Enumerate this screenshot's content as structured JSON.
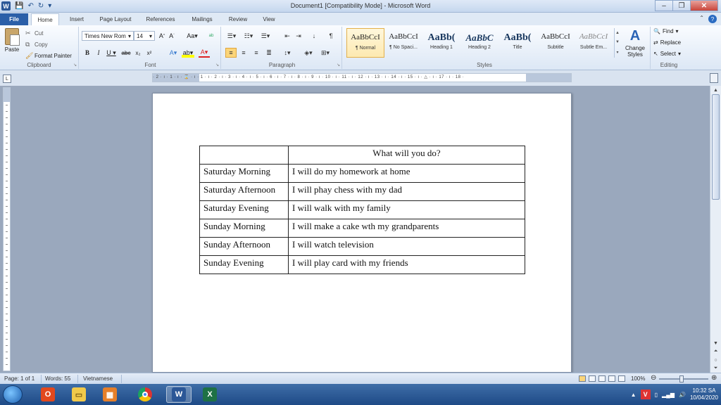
{
  "window": {
    "title": "Document1 [Compatibility Mode] - Microsoft Word"
  },
  "tabs": [
    "File",
    "Home",
    "Insert",
    "Page Layout",
    "References",
    "Mailings",
    "Review",
    "View"
  ],
  "ribbon": {
    "clipboard": {
      "paste": "Paste",
      "cut": "Cut",
      "copy": "Copy",
      "format_painter": "Format Painter",
      "label": "Clipboard"
    },
    "font": {
      "name": "Times New Rom",
      "size": "14",
      "label": "Font"
    },
    "paragraph": {
      "label": "Paragraph"
    },
    "styles": {
      "label": "Styles",
      "items": [
        {
          "sample": "AaBbCcI",
          "name": "¶ Normal"
        },
        {
          "sample": "AaBbCcI",
          "name": "¶ No Spaci..."
        },
        {
          "sample": "AaBb(",
          "name": "Heading 1"
        },
        {
          "sample": "AaBbC",
          "name": "Heading 2"
        },
        {
          "sample": "AaBb(",
          "name": "Title"
        },
        {
          "sample": "AaBbCcI",
          "name": "Subtitle"
        },
        {
          "sample": "AaBbCcI",
          "name": "Subtle Em..."
        }
      ],
      "change_styles": "Change Styles"
    },
    "editing": {
      "find": "Find",
      "replace": "Replace",
      "select": "Select",
      "label": "Editing"
    }
  },
  "ruler": {
    "numbers": "· 2 · ı · 1 · ı · ⌛ · ı · 1 · ı · 2 · ı · 3 · ı · 4 · ı · 5 · ı · 6 · ı · 7 · ı · 8 · ı · 9 · ı · 10 · ı · 11 · ı · 12 · ı · 13 · ı · 14 · ı · 15 · ı · △ · ı · 17 · ı · 18 ·"
  },
  "document": {
    "header": {
      "col1": "",
      "col2": "What will you do?"
    },
    "rows": [
      {
        "day": "Saturday Morning",
        "plan": "I will do my homework at home"
      },
      {
        "day": "Saturday Afternoon",
        "plan": "I will phay chess with my dad"
      },
      {
        "day": "Saturday Evening",
        "plan": "I will walk with my family"
      },
      {
        "day": "Sunday Morning",
        "plan": "I will make a cake wth my grandparents"
      },
      {
        "day": "Sunday Afternoon",
        "plan": "I will watch television"
      },
      {
        "day": "Sunday Evening",
        "plan": "I will play card with my friends"
      }
    ]
  },
  "status": {
    "page": "Page: 1 of 1",
    "words": "Words: 55",
    "language": "Vietnamese",
    "zoom": "100%"
  },
  "taskbar": {
    "time": "10:32 SA",
    "date": "10/04/2020"
  }
}
